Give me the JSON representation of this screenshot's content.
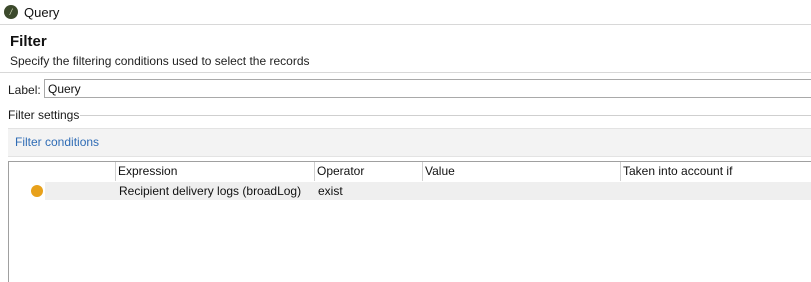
{
  "window": {
    "title": "Query",
    "icon": "app-logo-icon"
  },
  "header": {
    "title": "Filter",
    "subtitle": "Specify the filtering conditions used to select the records"
  },
  "label_field": {
    "caption": "Label:",
    "value": "Query"
  },
  "section": {
    "legend": "Filter settings"
  },
  "tabs": [
    {
      "label": "Filter conditions"
    }
  ],
  "table": {
    "columns": [
      "Expression",
      "Operator",
      "Value",
      "Taken into account if"
    ],
    "rows": [
      {
        "status_icon": "orange-dot-icon",
        "status_color": "#e8a11b",
        "expression": "Recipient delivery logs (broadLog)",
        "operator": "exist",
        "value": "",
        "taken_into_account_if": ""
      }
    ]
  }
}
